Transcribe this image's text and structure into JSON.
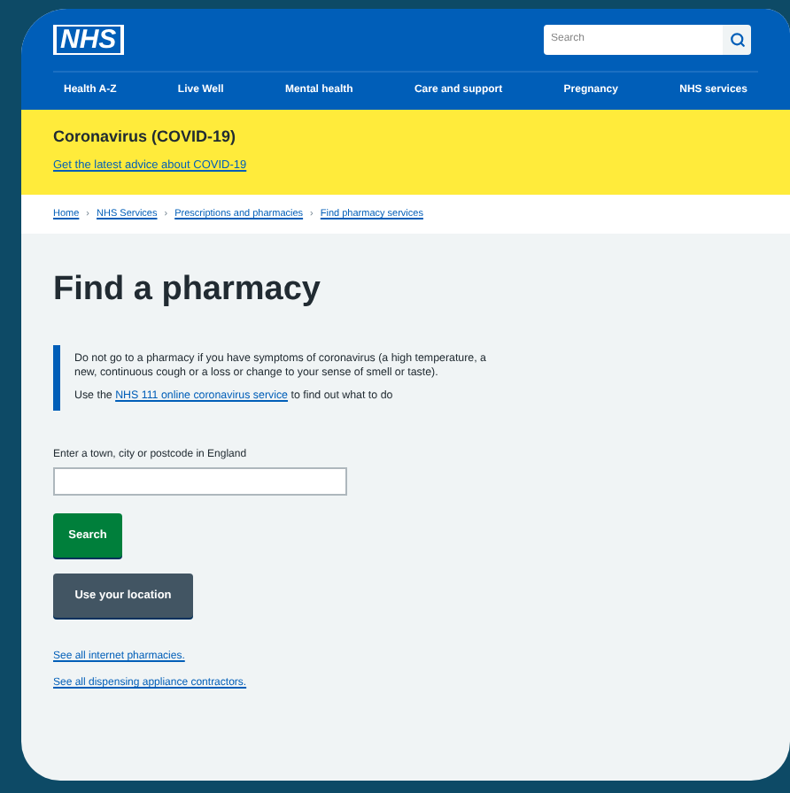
{
  "header": {
    "logo": "NHS",
    "search": {
      "placeholder": "Search"
    }
  },
  "nav": [
    "Health A-Z",
    "Live Well",
    "Mental health",
    "Care and support",
    "Pregnancy",
    "NHS services"
  ],
  "alert": {
    "title": "Coronavirus (COVID-19)",
    "link": "Get the latest advice about COVID-19"
  },
  "breadcrumb": [
    "Home",
    "NHS Services",
    "Prescriptions and pharmacies",
    "Find pharmacy services"
  ],
  "breadcrumb_separator": "›",
  "heading": "Find a pharmacy",
  "inset": {
    "text": "Do not go to a pharmacy if you have symptoms of coronavirus (a high temperature, a new, continuous cough or a loss or change to your sense of smell or taste).",
    "before": "Use the",
    "link": "NHS 111 online coronavirus service",
    "after": "to find out what to do"
  },
  "form": {
    "label": "Enter a town, city or postcode in England",
    "buttons": [
      {
        "label": "Search",
        "kind": "primary"
      },
      {
        "label": "Use your location",
        "kind": "secondary"
      }
    ]
  },
  "links": [
    "See all internet pharmacies.",
    "See all dispensing appliance contractors."
  ]
}
